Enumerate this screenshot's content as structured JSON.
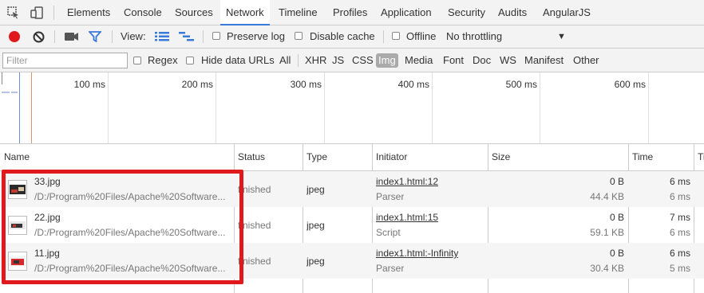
{
  "tabs": [
    "Elements",
    "Console",
    "Sources",
    "Network",
    "Timeline",
    "Profiles",
    "Application",
    "Security",
    "Audits",
    "AngularJS"
  ],
  "active_tab": "Network",
  "toolbar": {
    "view_label": "View:",
    "preserve_log": "Preserve log",
    "disable_cache": "Disable cache",
    "offline": "Offline",
    "throttling": "No throttling",
    "throttling_arrow": "▼"
  },
  "filter": {
    "placeholder": "Filter",
    "regex": "Regex",
    "hide_data_urls": "Hide data URLs",
    "types": [
      "All",
      "XHR",
      "JS",
      "CSS",
      "Img",
      "Media",
      "Font",
      "Doc",
      "WS",
      "Manifest",
      "Other"
    ],
    "active_type": "Img"
  },
  "overview": {
    "ticks": [
      "100 ms",
      "200 ms",
      "300 ms",
      "400 ms",
      "500 ms",
      "600 ms"
    ]
  },
  "columns": [
    "Name",
    "Status",
    "Type",
    "Initiator",
    "Size",
    "Time",
    "Ti"
  ],
  "rows": [
    {
      "name": "33.jpg",
      "path": "/D:/Program%20Files/Apache%20Software...",
      "status": "finished",
      "type": "jpeg",
      "initiator": "index1.html:12",
      "initiator_type": "Parser",
      "size": "0 B",
      "content": "44.4 KB",
      "time": "6 ms",
      "latency": "6 ms"
    },
    {
      "name": "22.jpg",
      "path": "/D:/Program%20Files/Apache%20Software...",
      "status": "finished",
      "type": "jpeg",
      "initiator": "index1.html:15",
      "initiator_type": "Script",
      "size": "0 B",
      "content": "59.1 KB",
      "time": "7 ms",
      "latency": "6 ms"
    },
    {
      "name": "11.jpg",
      "path": "/D:/Program%20Files/Apache%20Software...",
      "status": "finished",
      "type": "jpeg",
      "initiator": "index1.html:-Infinity",
      "initiator_type": "Parser",
      "size": "0 B",
      "content": "30.4 KB",
      "time": "6 ms",
      "latency": "5 ms"
    }
  ],
  "colors": {
    "highlight": "#e0191c",
    "record": "#e0191c",
    "accent": "#3879d9"
  }
}
